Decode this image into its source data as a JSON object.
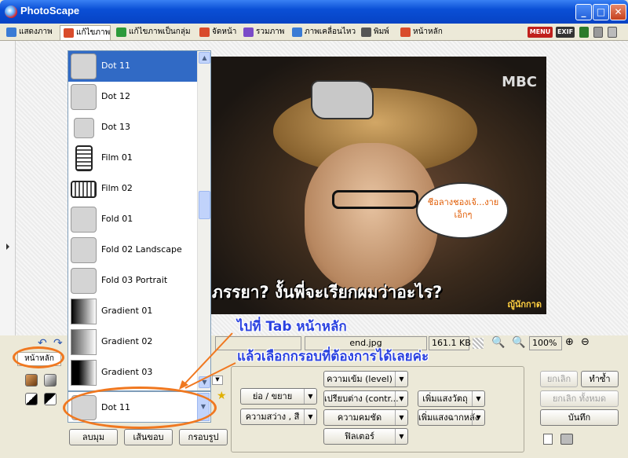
{
  "window": {
    "title": "PhotoScape"
  },
  "tabs": [
    {
      "label": "แสดงภาพ",
      "icon": "viewer-icon",
      "color": "#3a7bd5"
    },
    {
      "label": "แก้ไขภาพ",
      "icon": "editor-icon",
      "color": "#d94b2b",
      "active": true
    },
    {
      "label": "แก้ไขภาพเป็นกลุ่ม",
      "icon": "batch-icon",
      "color": "#2d9a3a"
    },
    {
      "label": "จัดหน้า",
      "icon": "page-icon",
      "color": "#d94b2b"
    },
    {
      "label": "รวมภาพ",
      "icon": "combine-icon",
      "color": "#7a4bc8"
    },
    {
      "label": "ภาพเคลื่อนไหว",
      "icon": "gif-icon",
      "color": "#3a7bd5"
    },
    {
      "label": "พิมพ์",
      "icon": "print-icon",
      "color": "#555555"
    },
    {
      "label": "หน้าหลัก",
      "icon": "home-icon",
      "color": "#d94b2b"
    }
  ],
  "toolbar_right": {
    "menu": "MENU",
    "exif": "EXIF"
  },
  "frame_list": [
    {
      "label": "Dot 11",
      "thumb": "plain",
      "selected": true
    },
    {
      "label": "Dot 12",
      "thumb": "plain"
    },
    {
      "label": "Dot 13",
      "thumb": "plain"
    },
    {
      "label": "Film 01",
      "thumb": "film"
    },
    {
      "label": "Film 02",
      "thumb": "film"
    },
    {
      "label": "Fold 01",
      "thumb": "plain"
    },
    {
      "label": "Fold 02 Landscape",
      "thumb": "plain"
    },
    {
      "label": "Fold 03 Portrait",
      "thumb": "plain"
    },
    {
      "label": "Gradient 01",
      "thumb": "grad"
    },
    {
      "label": "Gradient 02",
      "thumb": "grad"
    },
    {
      "label": "Gradient 03",
      "thumb": "grad"
    }
  ],
  "frame_combo": {
    "value": "Dot 11"
  },
  "photo": {
    "watermark": "MBC",
    "bubble": "ชีอลางชองเจ้...งาย เอ็กๆ",
    "subtitle": "ภรรยา? งั้นพี่จะเรียกผมว่าอะไร?",
    "signature": "ญู้นักกาด"
  },
  "status": {
    "filename": "end.jpg",
    "size": "161.1 KB",
    "zoom": "100%"
  },
  "annotations": {
    "line1": "ไปที่ Tab หน้าหลัก",
    "line2": "แล้วเลือกกรอบที่ต้องการได้เลยค่ะ"
  },
  "subtab": {
    "label": "หน้าหลัก"
  },
  "buttons": {
    "round": "ลบมุม",
    "border": "เส้นขอบ",
    "frame": "กรอบรูป",
    "resize": "ย่อ / ขยาย",
    "brightness": "ความสว่าง , สี",
    "level": "ความเข้ม (level)",
    "contrast": "เปรียบต่าง (contr...",
    "sharpen": "ความคมชัด",
    "filter": "ฟิลเตอร์",
    "backlight": "เพิ่มแสงวัตถุ",
    "bglight": "เพิ่มแสงฉากหลัง",
    "undo": "ยกเลิก",
    "redo": "ทำซ้ำ",
    "undo_all": "ยกเลิก ทั้งหมด",
    "save": "บันทึก"
  }
}
